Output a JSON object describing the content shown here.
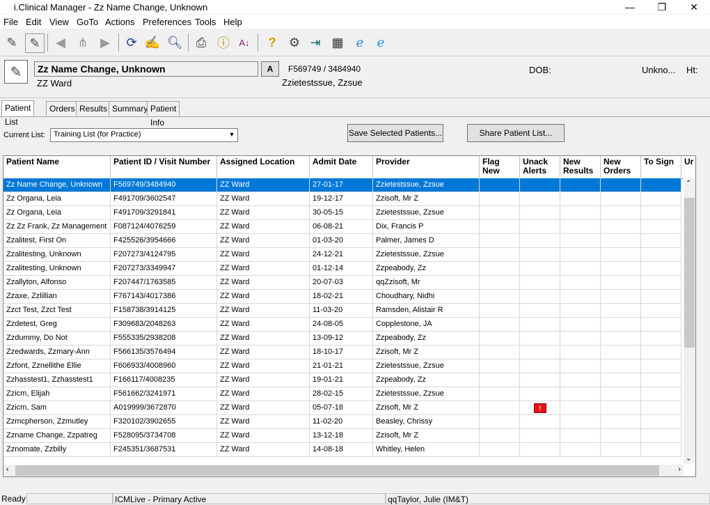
{
  "window": {
    "title": "i.Clinical Manager - Zz Name Change, Unknown",
    "min": "—",
    "max": "❐",
    "close": "✕"
  },
  "menu": [
    "File",
    "Edit",
    "View",
    "GoTo",
    "Actions",
    "Preferences",
    "Tools",
    "Help"
  ],
  "patient": {
    "name": "Zz Name Change, Unknown",
    "ward": "ZZ Ward",
    "a_button": "A",
    "ids": "F569749 / 3484940",
    "provider": "Zzietestssue, Zzsue",
    "dob_label": "DOB:",
    "sex": "Unkno...",
    "ht_label": "Ht:"
  },
  "tabs": [
    "Patient List",
    "Orders",
    "Results",
    "Summary",
    "Patient Info"
  ],
  "list": {
    "current_label": "Current List:",
    "current_value": "Training List (for Practice)",
    "save_button": "Save Selected Patients...",
    "share_button": "Share Patient List..."
  },
  "columns": [
    "Patient Name",
    "Patient ID / Visit Number",
    "Assigned Location",
    "Admit Date",
    "Provider",
    "Flag New",
    "Unack Alerts",
    "New Results",
    "New Orders",
    "To Sign",
    "Ur"
  ],
  "rows": [
    [
      "Zz Name Change, Unknown",
      "F569749/3484940",
      "ZZ Ward",
      "27-01-17",
      "Zzietestssue, Zzsue"
    ],
    [
      "Zz Organa, Leia",
      "F491709/3602547",
      "ZZ Ward",
      "19-12-17",
      "Zzisoft, Mr Z"
    ],
    [
      "Zz Organa, Leia",
      "F491709/3291841",
      "ZZ Ward",
      "30-05-15",
      "Zzietestssue, Zzsue"
    ],
    [
      "Zz Zz Frank, Zz Management",
      "F087124/4076259",
      "ZZ Ward",
      "06-08-21",
      "Dix, Francis P"
    ],
    [
      "Zzalitest, First On",
      "F425526/3954666",
      "ZZ Ward",
      "01-03-20",
      "Palmer, James D"
    ],
    [
      "Zzalitesting, Unknown",
      "F207273/4124795",
      "ZZ Ward",
      "24-12-21",
      "Zzietestssue, Zzsue"
    ],
    [
      "Zzalitesting, Unknown",
      "F207273/3349947",
      "ZZ Ward",
      "01-12-14",
      "Zzpeabody, Zz"
    ],
    [
      "Zzallyton, Alfonso",
      "F207447/1763585",
      "ZZ Ward",
      "20-07-03",
      "qqZzisoft, Mr"
    ],
    [
      "Zzaxe, Zzlillian",
      "F767143/4017386",
      "ZZ Ward",
      "18-02-21",
      "Choudhary, Nidhi"
    ],
    [
      "Zzct Test, Zzct Test",
      "F158738/3914125",
      "ZZ Ward",
      "11-03-20",
      "Ramsden, Alistair R"
    ],
    [
      "Zzdetest, Greg",
      "F309683/2048263",
      "ZZ Ward",
      "24-08-05",
      "Copplestone, JA"
    ],
    [
      "Zzdummy, Do Not",
      "F555335/2938208",
      "ZZ Ward",
      "13-09-12",
      "Zzpeabody, Zz"
    ],
    [
      "Zzedwards, Zzmary-Ann",
      "F566135/3576494",
      "ZZ Ward",
      "18-10-17",
      "Zzisoft, Mr Z"
    ],
    [
      "Zzfont, Zznellithe Ellie",
      "F606933/4008960",
      "ZZ Ward",
      "21-01-21",
      "Zzietestssue, Zzsue"
    ],
    [
      "Zzhasstest1, Zzhasstest1",
      "F166117/4008235",
      "ZZ Ward",
      "19-01-21",
      "Zzpeabody, Zz"
    ],
    [
      "Zzicm, Elijah",
      "F561662/3241971",
      "ZZ Ward",
      "28-02-15",
      "Zzietestssue, Zzsue"
    ],
    [
      "Zzicm, Sam",
      "A019999/3672870",
      "ZZ Ward",
      "05-07-18",
      "Zzisoft, Mr Z"
    ],
    [
      "Zzmcpherson, Zzmutley",
      "F320102/3902655",
      "ZZ Ward",
      "11-02-20",
      "Beasley, Chrissy"
    ],
    [
      "Zzname Change, Zzpatreg",
      "F528095/3734708",
      "ZZ Ward",
      "13-12-18",
      "Zzisoft, Mr Z"
    ],
    [
      "Zznomate, Zzbilly",
      "F245351/3687531",
      "ZZ Ward",
      "14-08-18",
      "Whitley, Helen"
    ]
  ],
  "alert_row": 16,
  "alert_color": "#e81123",
  "select_color": "#0078d7",
  "status": {
    "ready": "Ready",
    "server": "ICMLive - Primary Active",
    "user": "qqTaylor, Julie (IM&T)"
  }
}
